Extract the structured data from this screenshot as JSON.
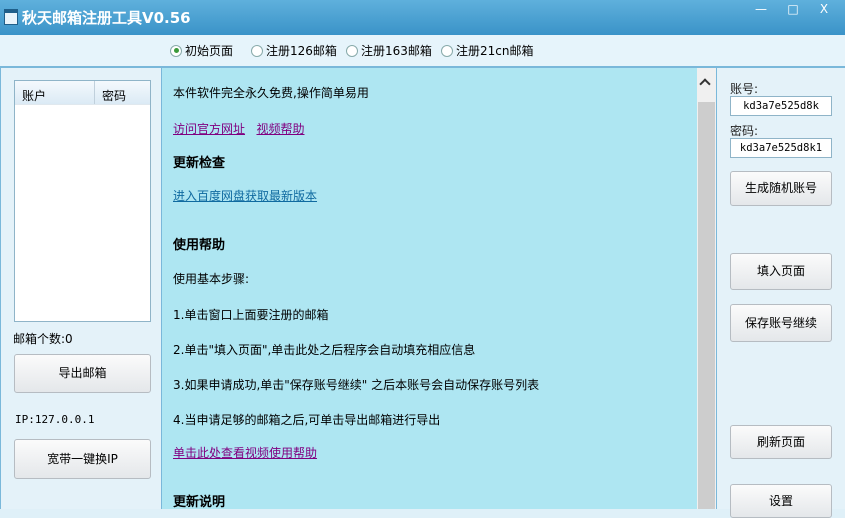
{
  "window": {
    "title": "秋天邮箱注册工具V0.56",
    "minimize": "—",
    "maximize": "□",
    "close": "X"
  },
  "options": [
    {
      "label": "初始页面",
      "selected": true
    },
    {
      "label": "注册126邮箱",
      "selected": false
    },
    {
      "label": "注册163邮箱",
      "selected": false
    },
    {
      "label": "注册21cn邮箱",
      "selected": false
    }
  ],
  "left": {
    "columns": [
      "账户",
      "密码"
    ],
    "count_label": "邮箱个数:0",
    "export_button": "导出邮箱",
    "ip_label": "IP:127.0.0.1",
    "change_ip_button": "宽带一键换IP"
  },
  "center": {
    "intro": "本件软件完全永久免费,操作简单易用",
    "link_site": "访问官方网址",
    "link_video": "视频帮助",
    "update_heading": "更新检查",
    "update_link": "进入百度网盘获取最新版本",
    "help_heading": "使用帮助",
    "steps_title": "使用基本步骤:",
    "steps": [
      "1.单击窗口上面要注册的邮箱",
      "2.单击\"填入页面\",单击此处之后程序会自动填充相应信息",
      "3.如果申请成功,单击\"保存账号继续\" 之后本账号会自动保存账号列表",
      "4.当申请足够的邮箱之后,可单击导出邮箱进行导出"
    ],
    "video_link": "单击此处查看视频使用帮助",
    "notes_heading": "更新说明"
  },
  "right": {
    "account_label": "账号:",
    "account_value": "kd3a7e525d8k",
    "password_label": "密码:",
    "password_value": "kd3a7e525d8k1",
    "generate_button": "生成随机账号",
    "fill_button": "填入页面",
    "save_button": "保存账号继续",
    "refresh_button": "刷新页面",
    "settings_button": "设置"
  }
}
